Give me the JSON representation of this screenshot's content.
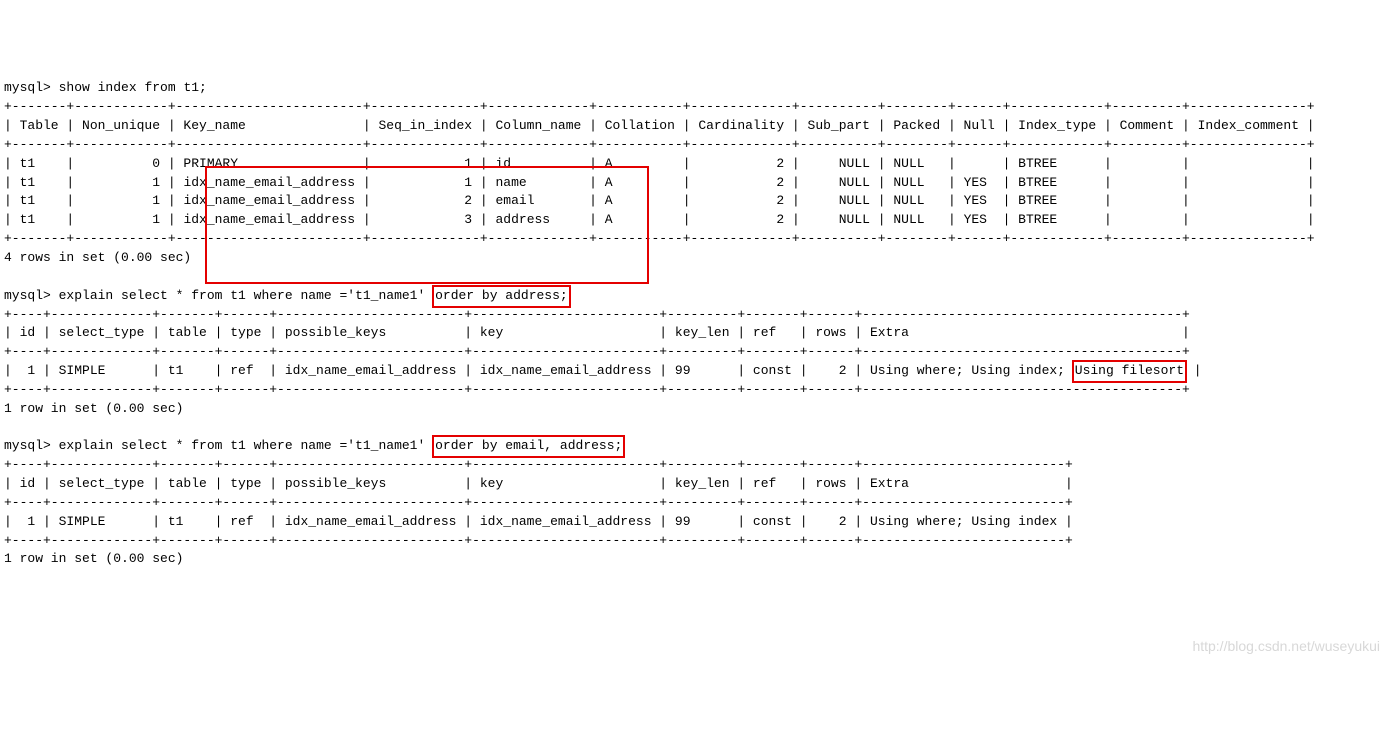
{
  "prompt": "mysql>",
  "cmd1": "show index from t1;",
  "sep_top": "+-------+------------+------------------------+--------------+-------------+-----------+-------------+----------+--------+------+------------+---------+---------------+",
  "hdr_line": "| Table | Non_unique | Key_name               | Seq_in_index | Column_name | Collation | Cardinality | Sub_part | Packed | Null | Index_type | Comment | Index_comment |",
  "row1": "| t1    |          0 | PRIMARY                |            1 | id          | A         |           2 |     NULL | NULL   |      | BTREE      |         |               |",
  "row2_a": "| t1    |          1 | ",
  "row2_b": "idx_name_email_address |            1 | name   ",
  "row2_c": "     | A         |           2 |     NULL | NULL   | YES  | BTREE      |         |               |",
  "row3_a": "| t1    |          1 | ",
  "row3_b": "idx_name_email_address |            2 | email  ",
  "row3_c": "     | A         |           2 |     NULL | NULL   | YES  | BTREE      |         |               |",
  "row4_a": "| t1    |          1 | ",
  "row4_b": "idx_name_email_address |            3 | address",
  "row4_c": "     | A         |           2 |     NULL | NULL   | YES  | BTREE      |         |               |",
  "res1": "4 rows in set (0.00 sec)",
  "cmd2_a": "explain select * from t1 where name ='t1_name1' ",
  "cmd2_b": "order by address;",
  "sep2": "+----+-------------+-------+------+------------------------+------------------------+---------+-------+------+-----------------------------------------+",
  "hdr2": "| id | select_type | table | type | possible_keys          | key                    | key_len | ref   | rows | Extra                                   |",
  "row2x_a": "|  1 | SIMPLE      | t1    | ref  | idx_name_email_address | idx_name_email_address | 99      | const |    2 | Using where; Using index; ",
  "row2x_b": "Using filesort",
  "row2x_c": " |",
  "res2": "1 row in set (0.00 sec)",
  "cmd3_a": "explain select * from t1 where name ='t1_name1' ",
  "cmd3_b": "order by email, address;",
  "sep3": "+----+-------------+-------+------+------------------------+------------------------+---------+-------+------+--------------------------+",
  "hdr3": "| id | select_type | table | type | possible_keys          | key                    | key_len | ref   | rows | Extra                    |",
  "row3x": "|  1 | SIMPLE      | t1    | ref  | idx_name_email_address | idx_name_email_address | 99      | const |    2 | Using where; Using index |",
  "res3": "1 row in set (0.00 sec)",
  "watermark": "http://blog.csdn.net/wuseyukui",
  "chart_data": {
    "type": "table",
    "tables": [
      {
        "title": "show index from t1",
        "columns": [
          "Table",
          "Non_unique",
          "Key_name",
          "Seq_in_index",
          "Column_name",
          "Collation",
          "Cardinality",
          "Sub_part",
          "Packed",
          "Null",
          "Index_type",
          "Comment",
          "Index_comment"
        ],
        "rows": [
          [
            "t1",
            0,
            "PRIMARY",
            1,
            "id",
            "A",
            2,
            "NULL",
            "NULL",
            "",
            "BTREE",
            "",
            ""
          ],
          [
            "t1",
            1,
            "idx_name_email_address",
            1,
            "name",
            "A",
            2,
            "NULL",
            "NULL",
            "YES",
            "BTREE",
            "",
            ""
          ],
          [
            "t1",
            1,
            "idx_name_email_address",
            2,
            "email",
            "A",
            2,
            "NULL",
            "NULL",
            "YES",
            "BTREE",
            "",
            ""
          ],
          [
            "t1",
            1,
            "idx_name_email_address",
            3,
            "address",
            "A",
            2,
            "NULL",
            "NULL",
            "YES",
            "BTREE",
            "",
            ""
          ]
        ],
        "summary": "4 rows in set (0.00 sec)"
      },
      {
        "title": "explain select * from t1 where name ='t1_name1' order by address",
        "columns": [
          "id",
          "select_type",
          "table",
          "type",
          "possible_keys",
          "key",
          "key_len",
          "ref",
          "rows",
          "Extra"
        ],
        "rows": [
          [
            1,
            "SIMPLE",
            "t1",
            "ref",
            "idx_name_email_address",
            "idx_name_email_address",
            99,
            "const",
            2,
            "Using where; Using index; Using filesort"
          ]
        ],
        "summary": "1 row in set (0.00 sec)"
      },
      {
        "title": "explain select * from t1 where name ='t1_name1' order by email, address",
        "columns": [
          "id",
          "select_type",
          "table",
          "type",
          "possible_keys",
          "key",
          "key_len",
          "ref",
          "rows",
          "Extra"
        ],
        "rows": [
          [
            1,
            "SIMPLE",
            "t1",
            "ref",
            "idx_name_email_address",
            "idx_name_email_address",
            99,
            "const",
            2,
            "Using where; Using index"
          ]
        ],
        "summary": "1 row in set (0.00 sec)"
      }
    ]
  }
}
